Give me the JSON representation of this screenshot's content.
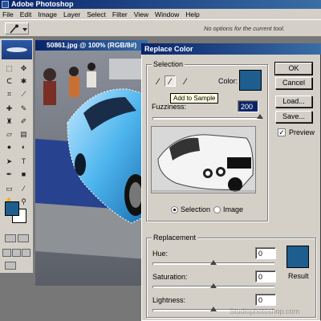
{
  "app": {
    "title": "Adobe Photoshop"
  },
  "menu": [
    "File",
    "Edit",
    "Image",
    "Layer",
    "Select",
    "Filter",
    "View",
    "Window",
    "Help"
  ],
  "options_bar": {
    "hint": "No options for the current tool."
  },
  "document": {
    "title": "50861.jpg @ 100% (RGB/8#)"
  },
  "toolbox": {
    "tools": [
      "marquee-tool",
      "move-tool",
      "lasso-tool",
      "magic-wand-tool",
      "crop-tool",
      "slice-tool",
      "healing-brush-tool",
      "brush-tool",
      "clone-stamp-tool",
      "history-brush-tool",
      "eraser-tool",
      "gradient-tool",
      "blur-tool",
      "dodge-tool",
      "path-selection-tool",
      "type-tool",
      "pen-tool",
      "shape-tool",
      "notes-tool",
      "eyedropper-tool",
      "hand-tool",
      "zoom-tool"
    ],
    "foreground_color": "#1d5e8f",
    "background_color": "#ffffff"
  },
  "dialog": {
    "title": "Replace Color",
    "selection_group": "Selection",
    "color_label": "Color:",
    "selection_color": "#1d5e8f",
    "tooltip": "Add to Sample",
    "fuzziness_label": "Fuzziness:",
    "fuzziness_value": "200",
    "fuzziness_level": 1.0,
    "radio_selection": "Selection",
    "radio_image": "Image",
    "selected_mode": "Selection",
    "replacement_group": "Replacement",
    "hue_label": "Hue:",
    "hue_value": "0",
    "saturation_label": "Saturation:",
    "saturation_value": "0",
    "lightness_label": "Lightness:",
    "lightness_value": "0",
    "result_label": "Result",
    "result_color": "#1d5e8f",
    "buttons": {
      "ok": "OK",
      "cancel": "Cancel",
      "load": "Load...",
      "save": "Save..."
    },
    "preview_label": "Preview",
    "preview_checked": true
  },
  "watermark": "Studiophotoshop.com"
}
